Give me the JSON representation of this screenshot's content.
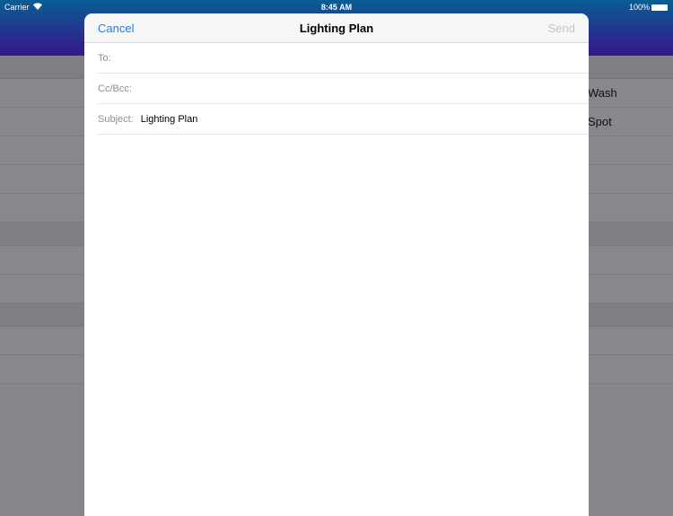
{
  "status_bar": {
    "carrier": "Carrier",
    "time": "8:45 AM",
    "battery": "100%",
    "icons": [
      "wifi-icon",
      "battery-icon"
    ]
  },
  "background_list": {
    "rows": [
      "",
      "Wash",
      "Spot",
      "",
      "",
      "",
      "",
      "",
      "",
      "",
      "",
      "",
      ""
    ]
  },
  "compose": {
    "cancel_label": "Cancel",
    "title": "Lighting Plan",
    "send_label": "Send",
    "to_label": "To:",
    "to_value": "",
    "ccbcc_label": "Cc/Bcc:",
    "ccbcc_value": "",
    "subject_label": "Subject:",
    "subject_value": "Lighting Plan",
    "body": ""
  },
  "colors": {
    "accent": "#1a7cf5",
    "send_disabled": "#c4c4c6",
    "header_top": "#0a5d92",
    "header_bottom": "#35178a"
  }
}
